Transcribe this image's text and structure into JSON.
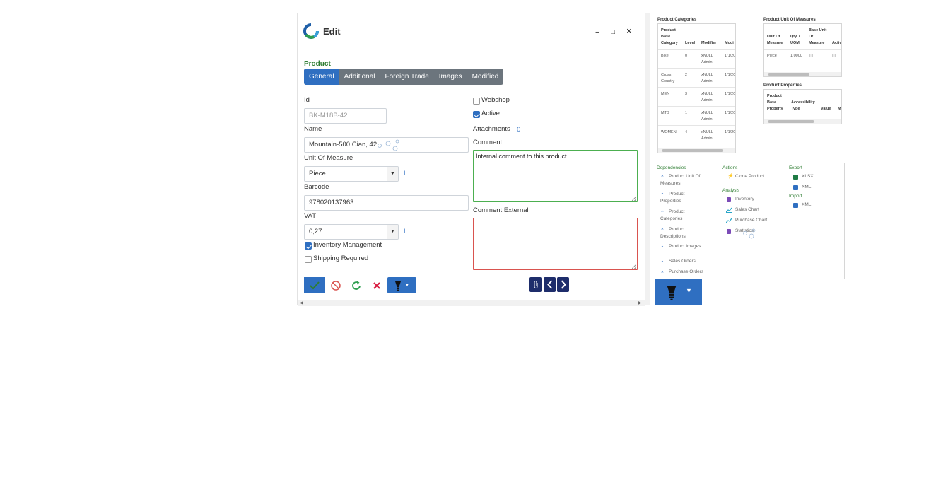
{
  "window": {
    "title": "Edit",
    "minimize_label": "−",
    "maximize_label": "□",
    "close_label": "×"
  },
  "form": {
    "section_title": "Product",
    "tabs": [
      {
        "label": "General",
        "active": true
      },
      {
        "label": "Additional",
        "active": false
      },
      {
        "label": "Foreign Trade",
        "active": false
      },
      {
        "label": "Images",
        "active": false
      },
      {
        "label": "Modified",
        "active": false
      }
    ],
    "id": {
      "label": "Id",
      "value": "BK-M18B-42"
    },
    "name": {
      "label": "Name",
      "value": "Mountain-500 Cian, 42"
    },
    "unit_of_measure": {
      "label": "Unit Of Measure",
      "value": "Piece",
      "link": "L"
    },
    "barcode": {
      "label": "Barcode",
      "value": "978020137963"
    },
    "vat": {
      "label": "VAT",
      "value": "0,27",
      "link": "L"
    },
    "inventory_management": {
      "label": "Inventory Management",
      "checked": true
    },
    "shipping_required": {
      "label": "Shipping Required",
      "checked": false
    },
    "webshop": {
      "label": "Webshop",
      "checked": false
    },
    "active": {
      "label": "Active",
      "checked": true
    },
    "attachments": {
      "label": "Attachments",
      "count": "0"
    },
    "comment": {
      "label": "Comment",
      "value": "Internal comment to this product."
    },
    "comment_external": {
      "label": "Comment External",
      "value": ""
    }
  },
  "colors": {
    "accent": "#2f6fc1",
    "save": "#2f6fc1",
    "tab_bar": "#6c757d",
    "section_title": "#2e7d32",
    "comment_border": "#4caf50",
    "comment_external_border": "#d9534f",
    "nav": "#1e2d6b"
  },
  "icons": {
    "save": "check-icon",
    "cancel": "ban-icon",
    "reload": "refresh-icon",
    "delete": "x-icon",
    "menu": "lightbulb-icon",
    "attach": "paperclip-icon",
    "prev": "chevron-left-icon",
    "next": "chevron-right-icon"
  },
  "categories_panel": {
    "title": "Product Categories",
    "headers": [
      "Product Base Category",
      "Level",
      "Modifier",
      "Modi"
    ],
    "rows": [
      {
        "category": "Bike",
        "level": "0",
        "modifier": "xNULL Admin",
        "modified": "1/1/20"
      },
      {
        "category": "Cross Country",
        "level": "2",
        "modifier": "xNULL Admin",
        "modified": "1/1/20"
      },
      {
        "category": "MEN",
        "level": "3",
        "modifier": "xNULL Admin",
        "modified": "1/1/20"
      },
      {
        "category": "MTB",
        "level": "1",
        "modifier": "xNULL Admin",
        "modified": "1/1/20"
      },
      {
        "category": "WOMEN",
        "level": "4",
        "modifier": "xNULL Admin",
        "modified": "1/1/20"
      }
    ]
  },
  "uom_panel": {
    "title": "Product Unit Of Measures",
    "headers": [
      "Unit Of Measure",
      "Qty. / UOM",
      "Base Unit Of Measure",
      "Activ"
    ],
    "rows": [
      {
        "uom": "Piece",
        "qty": "1,0000"
      }
    ]
  },
  "properties_panel": {
    "title": "Product Properties",
    "headers": [
      "Product Base Property",
      "Accessibility Type",
      "Value",
      "M"
    ]
  },
  "menu": {
    "dependencies": {
      "title": "Dependencies",
      "items": [
        "Product Unit Of Measures",
        "Product Properties",
        "Product Categories",
        "Product Descriptions",
        "Product Images",
        "Sales Orders",
        "Purchase Orders"
      ]
    },
    "actions": {
      "title": "Actions",
      "items": [
        "Clone Product"
      ]
    },
    "analysis": {
      "title": "Analysis",
      "items": [
        "Inventory",
        "Sales Chart",
        "Purchase Chart",
        "Statistics"
      ]
    },
    "export": {
      "title": "Export",
      "items": [
        "XLSX",
        "XML"
      ]
    },
    "import": {
      "title": "Import",
      "items": [
        "XML"
      ]
    }
  }
}
